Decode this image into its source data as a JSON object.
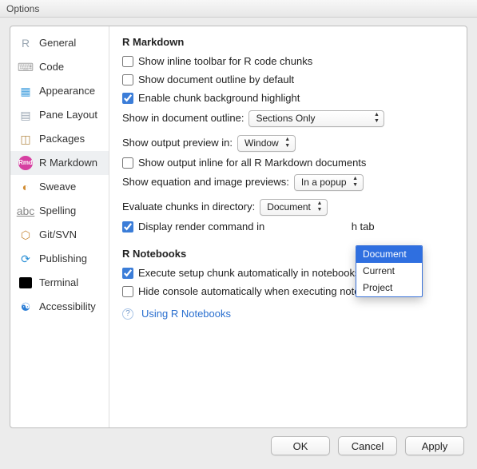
{
  "window": {
    "title": "Options"
  },
  "sidebar": {
    "items": [
      {
        "label": "General"
      },
      {
        "label": "Code"
      },
      {
        "label": "Appearance"
      },
      {
        "label": "Pane Layout"
      },
      {
        "label": "Packages"
      },
      {
        "label": "R Markdown"
      },
      {
        "label": "Sweave"
      },
      {
        "label": "Spelling"
      },
      {
        "label": "Git/SVN"
      },
      {
        "label": "Publishing"
      },
      {
        "label": "Terminal"
      },
      {
        "label": "Accessibility"
      }
    ],
    "selected_index": 5
  },
  "content": {
    "section1_title": "R Markdown",
    "inline_toolbar": "Show inline toolbar for R code chunks",
    "doc_outline_default": "Show document outline by default",
    "chunk_bg": "Enable chunk background highlight",
    "show_in_outline_label": "Show in document outline:",
    "show_in_outline_value": "Sections Only",
    "output_preview_label": "Show output preview in:",
    "output_preview_value": "Window",
    "output_inline": "Show output inline for all R Markdown documents",
    "eq_img_preview_label": "Show equation and image previews:",
    "eq_img_preview_value": "In a popup",
    "eval_dir_label": "Evaluate chunks in directory:",
    "eval_dir_value": "Document",
    "eval_dir_options": [
      "Document",
      "Current",
      "Project"
    ],
    "display_render": "Display render command in",
    "display_render_tail": "h tab",
    "section2_title": "R Notebooks",
    "exec_setup": "Execute setup chunk automatically in notebooks",
    "hide_console": "Hide console automatically when executing notebook chunks",
    "link_text": "Using R Notebooks"
  },
  "buttons": {
    "ok": "OK",
    "cancel": "Cancel",
    "apply": "Apply"
  }
}
